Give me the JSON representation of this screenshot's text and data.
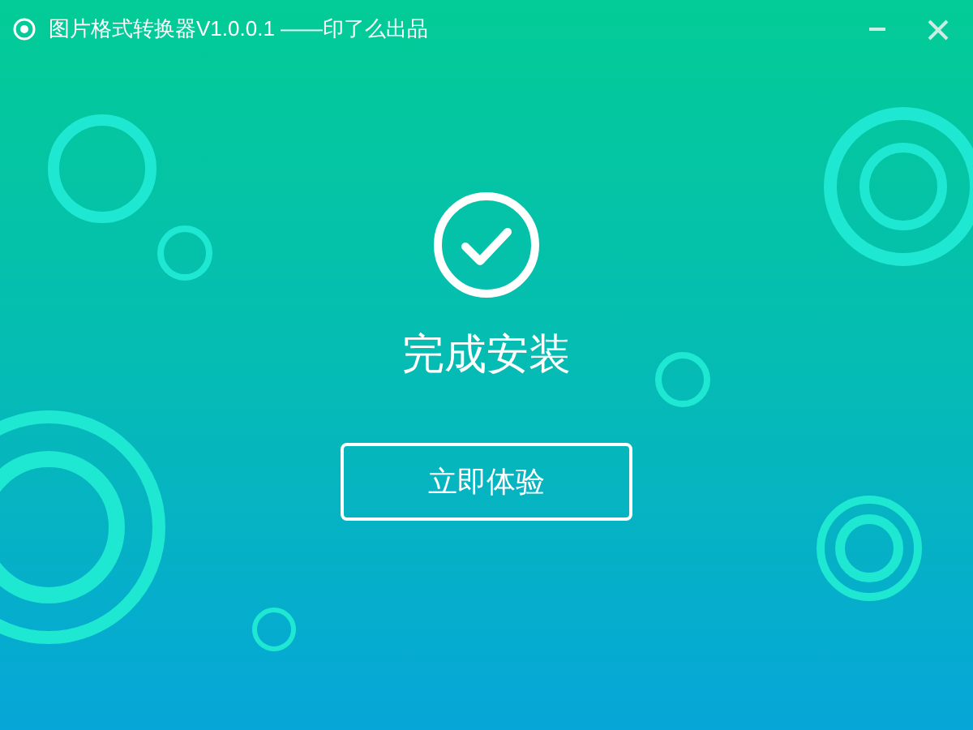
{
  "window": {
    "title": "图片格式转换器V1.0.0.1 ——印了么出品"
  },
  "status": {
    "message": "完成安装"
  },
  "buttons": [
    {
      "label": "立即体验"
    }
  ]
}
